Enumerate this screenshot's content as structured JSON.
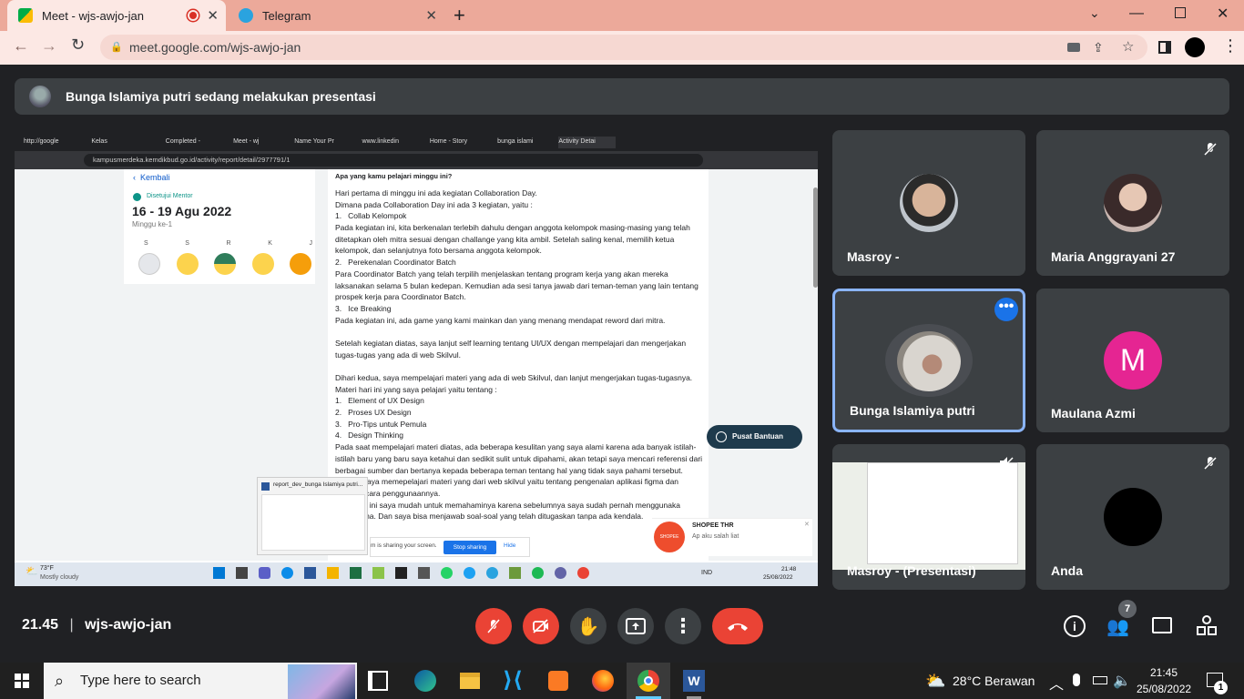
{
  "tabs": [
    {
      "title": "Meet - wjs-awjo-jan",
      "active": true
    },
    {
      "title": "Telegram",
      "active": false
    }
  ],
  "url": "meet.google.com/wjs-awjo-jan",
  "banner": "Bunga Islamiya putri sedang melakukan presentasi",
  "participants": [
    {
      "name": "Masroy -"
    },
    {
      "name": "Maria Anggrayani 27"
    },
    {
      "name": "Bunga Islamiya putri"
    },
    {
      "name": "Maulana Azmi",
      "initial": "M"
    },
    {
      "name": "Masroy - (Presentasi)"
    },
    {
      "name": "Anda"
    }
  ],
  "meeting": {
    "time": "21.45",
    "separator": "|",
    "code": "wjs-awjo-jan",
    "people_count": "7"
  },
  "shared": {
    "tabs": [
      "http://google",
      "Kelas",
      "Completed - ",
      "Meet - wj",
      "Name Your Pr",
      "www.linkedin",
      "Home - Story",
      "bunga islami",
      "Activity Detai"
    ],
    "url": "kampusmerdeka.kemdikbud.go.id/activity/report/detail/2977791/1",
    "back": "Kembali",
    "approved": "Disetujui Mentor",
    "date_range": "16 - 19 Agu 2022",
    "week": "Minggu ke-1",
    "days": [
      "S",
      "S",
      "R",
      "K",
      "J"
    ],
    "question": "Apa yang kamu pelajari minggu ini?",
    "lines": [
      "Hari pertama di minggu ini ada kegiatan Collaboration Day.",
      "Dimana pada Collaboration Day ini ada 3 kegiatan, yaitu :",
      "1.   Collab Kelompok",
      "Pada kegiatan ini, kita berkenalan terlebih dahulu dengan anggota kelompok masing-masing yang telah",
      "ditetapkan oleh mitra sesuai dengan challange yang kita ambil. Setelah saling kenal, memilih ketua",
      "kelompok, dan selanjutnya foto bersama anggota kelompok.",
      "2.   Perekenalan Coordinator Batch",
      "Para Coordinator Batch yang telah terpilih menjelaskan tentang program kerja yang akan mereka",
      "laksanakan selama 5 bulan kedepan. Kemudian ada sesi tanya jawab dari teman-teman yang lain tentang",
      "prospek kerja para Coordinator Batch.",
      "3.   Ice Breaking",
      "Pada kegiatan ini, ada game yang kami mainkan dan yang menang mendapat reword dari mitra.",
      "",
      "Setelah kegiatan diatas, saya lanjut self learning tentang UI/UX dengan mempelajari dan mengerjakan",
      "tugas-tugas yang ada di web Skilvul.",
      "",
      "Dihari kedua, saya mempelajari materi yang ada di web Skilvul, dan lanjut mengerjakan tugas-tugasnya.",
      "Materi hari ini yang saya pelajari yaitu tentang :",
      "1.   Element of UX Design",
      "2.   Proses UX Design",
      "3.   Pro-Tips untuk Pemula",
      "4.   Design Thinking",
      "Pada saat mempelajari materi diatas, ada beberapa kesulitan yang saya alami karena ada banyak istilah-",
      "istilah baru yang baru saya ketahui dan sedikit sulit untuk dipahami, akan tetapi saya mencari referensi dari",
      "berbagai sumber dan bertanya kepada beberapa teman tentang hal yang tidak saya pahami tersebut.",
      "           , saya memepelajari materi yang dari web skilvul yaitu tentang pengenalan aplikasi figma dan",
      "           a cara penggunaannya.",
      "           eri ini saya mudah untuk memahaminya karena sebelumnya saya sudah pernah menggunaka",
      "           gma. Dan saya bisa menjawab soal-soal yang telah ditugaskan tanpa ada kendala."
    ],
    "help_button": "Pusat Bantuan",
    "popup_title": "report_dev_bunga Islamiya putri...",
    "sharing_text": "m is sharing your screen.",
    "stop_sharing": "Stop sharing",
    "hide": "Hide",
    "notif_title": "SHOPEE THR",
    "notif_sub": "Ap aku salah liat",
    "notif_logo": "SHOPEE",
    "weather_temp": "73°F",
    "weather_desc": "Mostly cloudy",
    "tray_lang": "IND",
    "tray_time": "21:48",
    "tray_date": "25/08/2022"
  },
  "taskbar": {
    "search_placeholder": "Type here to search",
    "weather": "28°C  Berawan",
    "time": "21:45",
    "date": "25/08/2022",
    "notif_count": "1"
  },
  "colors": {
    "tabbar": "#eca99a",
    "addrbar": "#fce8e4",
    "meet_bg": "#202124",
    "tile": "#3c4043",
    "red": "#ea4335",
    "accent": "#1a73e8",
    "maulana_avatar": "#e52592"
  }
}
